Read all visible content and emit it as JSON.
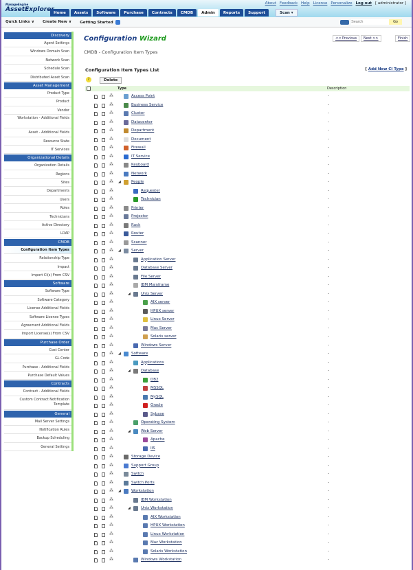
{
  "header": {
    "logo_small": "ManageEngine",
    "logo": "AssetExplorer",
    "links": [
      "About",
      "Feedback",
      "Help",
      "License",
      "Personalize"
    ],
    "logout": "Log out",
    "user": "[ administrator ]",
    "tabs": [
      "Home",
      "Assets",
      "Software",
      "Purchase",
      "Contracts",
      "CMDB",
      "Admin",
      "Reports",
      "Support"
    ],
    "active_tab": "Admin",
    "scan": "Scan ▾"
  },
  "toolbar": {
    "quick_links": "Quick Links  ∨",
    "create_new": "Create New  ∨",
    "getting_started": "Getting Started",
    "search_placeholder": "Search",
    "go": "Go"
  },
  "sidebar": [
    {
      "h": "Discovery",
      "items": [
        "Agent Settings",
        "Windows Domain Scan",
        "Network Scan",
        "Schedule Scan",
        "Distributed Asset Scan"
      ]
    },
    {
      "h": "Asset Management",
      "items": [
        "Product Type",
        "Product",
        "Vendor",
        "Workstation - Additional Fields",
        "Asset - Additional Fields",
        "Resource State",
        "IT Services"
      ]
    },
    {
      "h": "Organizational Details",
      "items": [
        "Organization Details",
        "Regions",
        "Sites",
        "Departments",
        "Users",
        "Roles",
        "Technicians",
        "Active Directory",
        "LDAP"
      ]
    },
    {
      "h": "CMDB",
      "items": [
        "Configuration Item Types",
        "Relationship Type",
        "Impact",
        "Import CI(s) From CSV"
      ]
    },
    {
      "h": "Software",
      "items": [
        "Software Type",
        "Software Category",
        "License Additional Fields",
        "Software License Types",
        "Agreement Additional Fields",
        "Import License(s) From CSV"
      ]
    },
    {
      "h": "Purchase Order",
      "items": [
        "Cost Center",
        "GL Code",
        "Purchase - Additional Fields",
        "Purchase Default Values"
      ]
    },
    {
      "h": "Contracts",
      "items": [
        "Contract - Additional Fields",
        "Custom Contract Notification Template"
      ]
    },
    {
      "h": "General",
      "items": [
        "Mail Server Settings",
        "Notification Rules",
        "Backup Scheduling",
        "General Settings"
      ]
    }
  ],
  "selected_sidebar": "Configuration Item Types",
  "main": {
    "wizard_a": "Configuration ",
    "wizard_b": "Wizard",
    "prev": "<< Previous",
    "next": "Next >>",
    "finish": "Finish",
    "breadcrumb": "CMDB  -  Configuration Item Types",
    "list_title": "Configuration Item Types List",
    "add_new_open": "[ ",
    "add_new": "Add New CI Type",
    "add_new_close": " ]",
    "help": "?",
    "delete": "Delete",
    "col_type": "Type",
    "col_desc": "Description"
  },
  "rows": [
    [
      "Access Point",
      0,
      0,
      "#6a9fd0"
    ],
    [
      "Business Service",
      0,
      0,
      "#4a8a4a"
    ],
    [
      "Cluster",
      0,
      0,
      "#5a7ab0"
    ],
    [
      "Datacenter",
      0,
      0,
      "#6a6a9a"
    ],
    [
      "Department",
      0,
      0,
      "#c08a30"
    ],
    [
      "Document",
      0,
      0,
      "#dddddd"
    ],
    [
      "Firewall",
      0,
      0,
      "#d0602a"
    ],
    [
      "IT Service",
      0,
      0,
      "#2a6ad0"
    ],
    [
      "Keyboard",
      0,
      0,
      "#888888"
    ],
    [
      "Network",
      0,
      0,
      "#4a7ac0"
    ],
    [
      "People",
      0,
      1,
      "#d0a030"
    ],
    [
      "Requester",
      1,
      0,
      "#3a6ac0"
    ],
    [
      "Technician",
      1,
      0,
      "#2a9a2a"
    ],
    [
      "Printer",
      0,
      0,
      "#8a8a8a"
    ],
    [
      "Projector",
      0,
      0,
      "#6a7a9a"
    ],
    [
      "Rack",
      0,
      0,
      "#7a7a7a"
    ],
    [
      "Router",
      0,
      0,
      "#3a5a9a"
    ],
    [
      "Scanner",
      0,
      0,
      "#9a9a9a"
    ],
    [
      "Server",
      0,
      1,
      "#7a8aa0"
    ],
    [
      "Application Server",
      1,
      0,
      "#6a7a90"
    ],
    [
      "Database Server",
      1,
      0,
      "#6a7a90"
    ],
    [
      "File Server",
      1,
      0,
      "#6a7a90"
    ],
    [
      "IBM Mainframe",
      1,
      0,
      "#aaaaaa"
    ],
    [
      "Unix Server",
      1,
      1,
      "#6a7a90"
    ],
    [
      "AIX server",
      2,
      0,
      "#4aa04a"
    ],
    [
      "HPUX server",
      2,
      0,
      "#5a5a5a"
    ],
    [
      "Linux Server",
      2,
      0,
      "#e0c040"
    ],
    [
      "Mac Server",
      2,
      0,
      "#7a7a9a"
    ],
    [
      "Solaris server",
      2,
      0,
      "#d0a050"
    ],
    [
      "Windows Server",
      1,
      0,
      "#4a6ab0"
    ],
    [
      "Software",
      0,
      1,
      "#4a8ad0"
    ],
    [
      "Applications",
      1,
      0,
      "#4a9ac0"
    ],
    [
      "Database",
      1,
      1,
      "#7a7a7a"
    ],
    [
      "DB2",
      2,
      0,
      "#3aa03a"
    ],
    [
      "MSSQL",
      2,
      0,
      "#c04040"
    ],
    [
      "MySQL",
      2,
      0,
      "#4a7ab0"
    ],
    [
      "Oracle",
      2,
      0,
      "#d02020"
    ],
    [
      "Sybase",
      2,
      0,
      "#5a5a8a"
    ],
    [
      "Operating System",
      1,
      0,
      "#4aa06a"
    ],
    [
      "Web Server",
      1,
      1,
      "#4a8ac0"
    ],
    [
      "Apache",
      2,
      0,
      "#9a4a9a"
    ],
    [
      "IIS",
      2,
      0,
      "#4a6ab0"
    ],
    [
      "Storage Device",
      0,
      0,
      "#6a6a6a"
    ],
    [
      "Support Group",
      0,
      0,
      "#4a7ad0"
    ],
    [
      "Switch",
      0,
      0,
      "#7a8a9a"
    ],
    [
      "Switch Ports",
      0,
      0,
      "#5a7a9a"
    ],
    [
      "Workstation",
      0,
      1,
      "#4a7ac0"
    ],
    [
      "IBM Workstation",
      1,
      0,
      "#6a7a90"
    ],
    [
      "Unix Workstation",
      1,
      1,
      "#6a7a90"
    ],
    [
      "AIX Workstation",
      2,
      0,
      "#5a7ab0"
    ],
    [
      "HPUX Workstation",
      2,
      0,
      "#5a7ab0"
    ],
    [
      "Linux Workstation",
      2,
      0,
      "#5a7ab0"
    ],
    [
      "Mac Workstation",
      2,
      0,
      "#5a7ab0"
    ],
    [
      "Solaris Workstation",
      2,
      0,
      "#5a7ab0"
    ],
    [
      "Windows Workstation",
      1,
      0,
      "#5a7ab0"
    ]
  ],
  "row_desc": "-"
}
